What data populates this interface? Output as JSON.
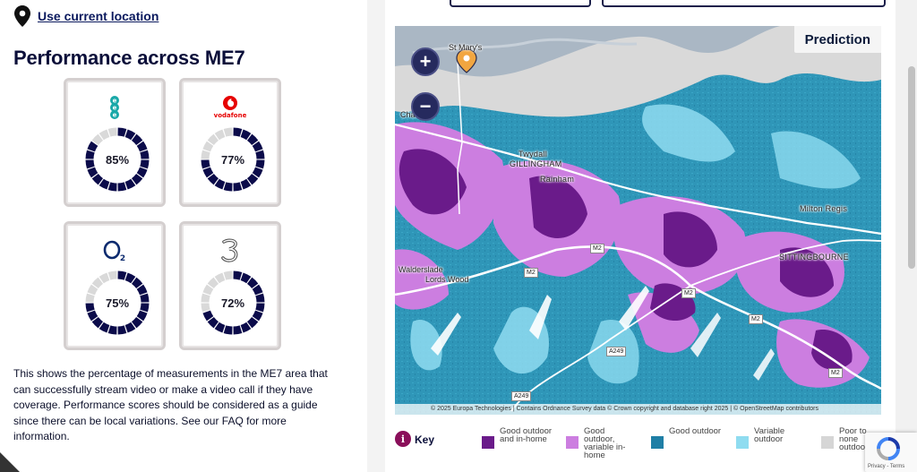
{
  "location": {
    "link_label": "Use current location"
  },
  "performance": {
    "title": "Performance across ME7",
    "operators": [
      {
        "id": "ee",
        "icon": "ee-logo-icon",
        "value_label": "85%",
        "value": 85,
        "color": "#0b0b4a"
      },
      {
        "id": "vodafone",
        "icon": "vodafone-logo-icon",
        "logo_text": "vodafone",
        "value_label": "77%",
        "value": 77,
        "color": "#0b0b4a"
      },
      {
        "id": "o2",
        "icon": "o2-logo-icon",
        "value_label": "75%",
        "value": 75,
        "color": "#0b0b4a"
      },
      {
        "id": "three",
        "icon": "three-logo-icon",
        "value_label": "72%",
        "value": 72,
        "color": "#0b0b4a"
      }
    ],
    "description": "This shows the percentage of measurements in the ME7 area that can successfully stream video or make a video call if they have coverage. Performance scores should be considered as a guide since there can be local variations. See our FAQ for more information."
  },
  "map": {
    "badge": "Prediction",
    "zoom_in_label": "+",
    "zoom_out_label": "−",
    "attribution": "© 2025 Europa Technologies | Contains Ordnance Survey data © Crown copyright and database right 2025 | © OpenStreetMap contributors",
    "places": {
      "st_marys": "St Mary's",
      "chatham": "Chatham",
      "twydall": "Twydall",
      "gillingham": "GILLINGHAM",
      "rainham": "Rainham",
      "milton_regis": "Milton Regis",
      "sittingbourne": "SITTINGBOURNE",
      "walderslade": "Walderslade",
      "lords_wood": "Lords Wood"
    },
    "roads": {
      "m2_a": "M2",
      "m2_b": "M2",
      "m2_c": "M2",
      "m2_d": "M2",
      "m2_e": "M2",
      "a249_a": "A249",
      "a249_b": "A249"
    }
  },
  "key": {
    "label": "Key",
    "info_icon_text": "i",
    "items": [
      {
        "text": "Good outdoor and in-home",
        "color": "#6a1b8a"
      },
      {
        "text": "Good outdoor, variable in-home",
        "color": "#cc7ee0"
      },
      {
        "text": "Good outdoor",
        "color": "#1f7fa6"
      },
      {
        "text": "Variable outdoor",
        "color": "#8fdcf0"
      },
      {
        "text": "Poor to none outdoor",
        "color": "#d6d6d6"
      }
    ]
  },
  "recaptcha": {
    "terms": "Privacy - Terms"
  }
}
